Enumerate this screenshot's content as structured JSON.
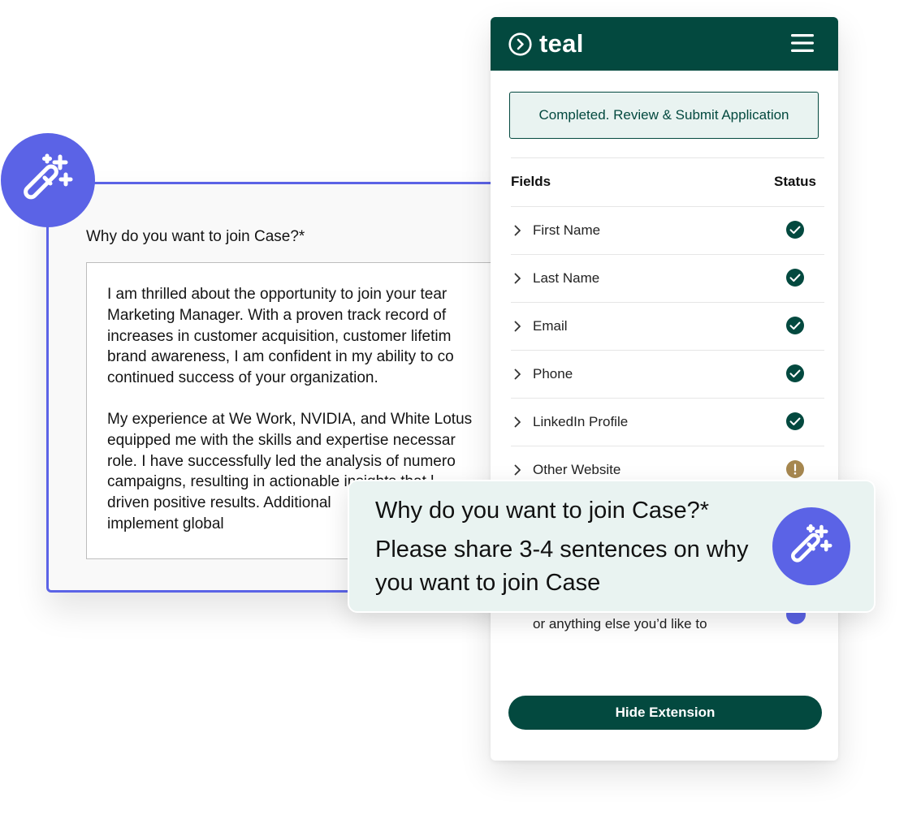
{
  "form": {
    "question": "Why do you want to join Case?*",
    "answer_paragraphs": [
      "I am thrilled about the opportunity to join your tear\nMarketing Manager. With a proven track record of \nincreases in customer acquisition, customer lifetim\nbrand awareness, I am confident in my ability to co\ncontinued success of your organization.",
      "My experience at We Work, NVIDIA, and White Lotus\nequipped me with the skills and expertise necessar\nrole. I have successfully led the analysis of numero\ncampaigns, resulting in actionable insights that l\ndriven positive results. Additional\nimplement global"
    ]
  },
  "extension": {
    "logo_text": "teal",
    "logo_icon": "chevron-circle-icon",
    "menu_icon": "hamburger-menu-icon",
    "status_banner": "Completed. Review & Submit Application",
    "table": {
      "col_fields": "Fields",
      "col_status": "Status",
      "rows": [
        {
          "label": "First Name",
          "status": "complete"
        },
        {
          "label": "Last Name",
          "status": "complete"
        },
        {
          "label": "Email",
          "status": "complete"
        },
        {
          "label": "Phone",
          "status": "complete"
        },
        {
          "label": "LinkedIn Profile",
          "status": "complete"
        },
        {
          "label": "Other Website",
          "status": "warning"
        }
      ]
    },
    "partial_row_text": "or anything else you’d like to",
    "hide_button": "Hide Extension"
  },
  "tooltip": {
    "title": "Why do you want to join Case?*",
    "body": "Please share 3-4 sentences on why you want to join Case"
  },
  "colors": {
    "brand_green": "#03493f",
    "accent_purple": "#5b63e6",
    "warning_gold": "#a6874f",
    "tip_bg": "#e9f3f1"
  }
}
